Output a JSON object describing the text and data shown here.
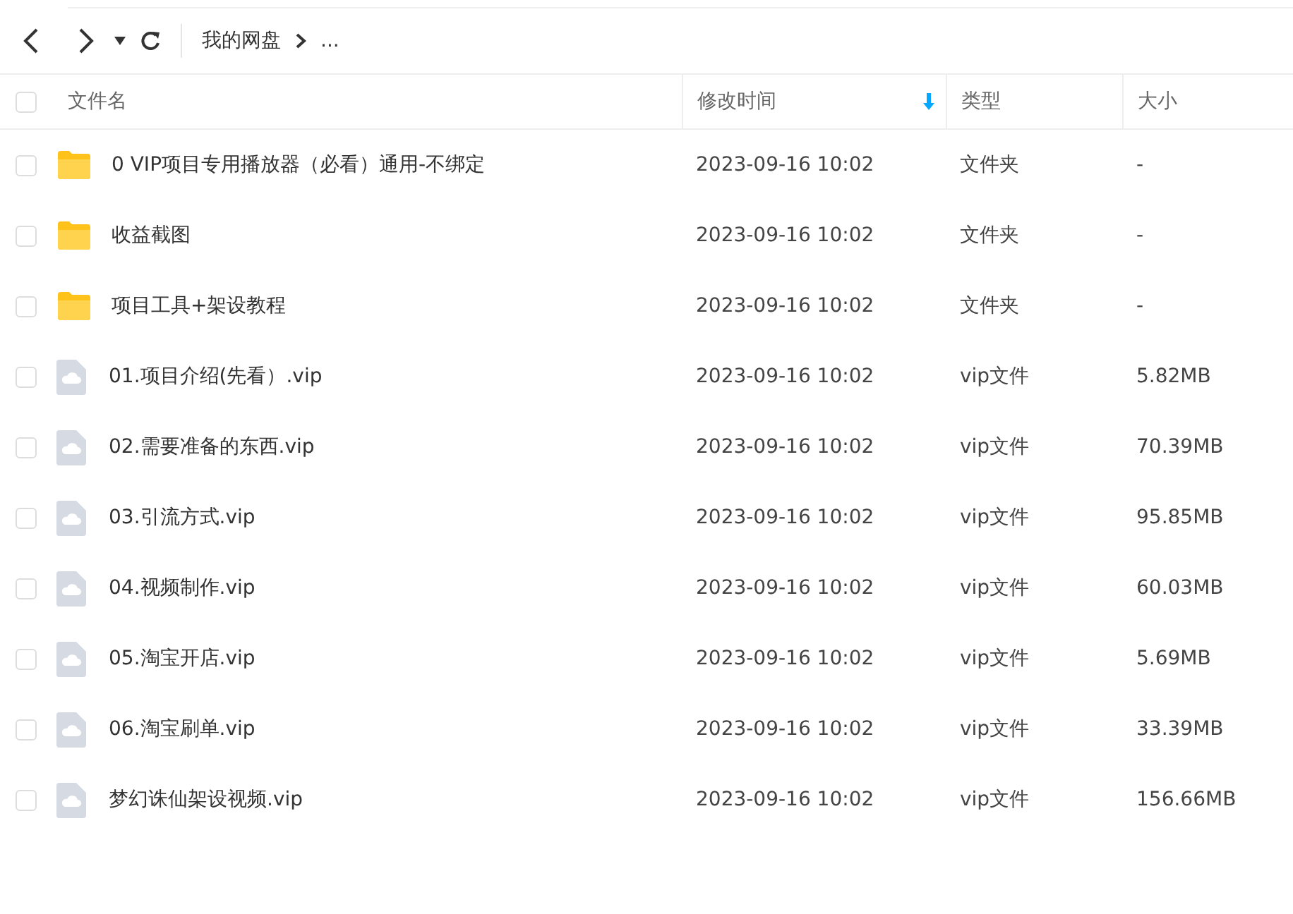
{
  "toolbar": {
    "breadcrumb": [
      {
        "label": "我的网盘"
      },
      {
        "label": "..."
      }
    ]
  },
  "table": {
    "select_all": {
      "checked": false
    },
    "columns": [
      {
        "label": "文件名",
        "sorted": false
      },
      {
        "label": "修改时间",
        "sorted": true
      },
      {
        "label": "类型",
        "sorted": false
      },
      {
        "label": "大小",
        "sorted": false
      }
    ],
    "rows": [
      {
        "kind": "folder",
        "checked": false,
        "name": "0 VIP项目专用播放器（必看）通用-不绑定",
        "modified": "2023-09-16 10:02",
        "type": "文件夹",
        "size": "-"
      },
      {
        "kind": "folder",
        "checked": false,
        "name": "收益截图",
        "modified": "2023-09-16 10:02",
        "type": "文件夹",
        "size": "-"
      },
      {
        "kind": "folder",
        "checked": false,
        "name": "项目工具+架设教程",
        "modified": "2023-09-16 10:02",
        "type": "文件夹",
        "size": "-"
      },
      {
        "kind": "file",
        "checked": false,
        "name": "01.项目介绍(先看）.vip",
        "modified": "2023-09-16 10:02",
        "type": "vip文件",
        "size": "5.82MB"
      },
      {
        "kind": "file",
        "checked": false,
        "name": "02.需要准备的东西.vip",
        "modified": "2023-09-16 10:02",
        "type": "vip文件",
        "size": "70.39MB"
      },
      {
        "kind": "file",
        "checked": false,
        "name": "03.引流方式.vip",
        "modified": "2023-09-16 10:02",
        "type": "vip文件",
        "size": "95.85MB"
      },
      {
        "kind": "file",
        "checked": false,
        "name": "04.视频制作.vip",
        "modified": "2023-09-16 10:02",
        "type": "vip文件",
        "size": "60.03MB"
      },
      {
        "kind": "file",
        "checked": false,
        "name": "05.淘宝开店.vip",
        "modified": "2023-09-16 10:02",
        "type": "vip文件",
        "size": "5.69MB"
      },
      {
        "kind": "file",
        "checked": false,
        "name": "06.淘宝刷单.vip",
        "modified": "2023-09-16 10:02",
        "type": "vip文件",
        "size": "33.39MB"
      },
      {
        "kind": "file",
        "checked": false,
        "name": "梦幻诛仙架设视频.vip",
        "modified": "2023-09-16 10:02",
        "type": "vip文件",
        "size": "156.66MB"
      }
    ]
  }
}
